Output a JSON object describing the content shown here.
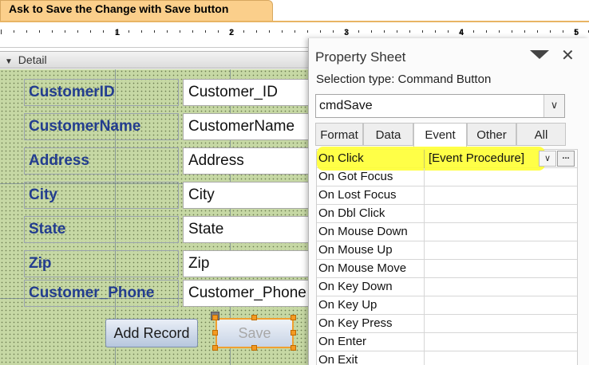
{
  "window": {
    "title": "Ask to Save the Change with Save button"
  },
  "ruler": {
    "numbers": [
      "1",
      "2",
      "3",
      "4",
      "5"
    ]
  },
  "detail_section": {
    "label": "Detail",
    "collapse_icon": "chevron-down-icon"
  },
  "form_fields": [
    {
      "label": "CustomerID",
      "control": "Customer_ID"
    },
    {
      "label": "CustomerName",
      "control": "CustomerName"
    },
    {
      "label": "Address",
      "control": "Address"
    },
    {
      "label": "City",
      "control": "City"
    },
    {
      "label": "State",
      "control": "State"
    },
    {
      "label": "Zip",
      "control": "Zip"
    },
    {
      "label": "Customer_Phone",
      "control": "Customer_Phone"
    }
  ],
  "buttons": {
    "add_record": "Add Record",
    "save": "Save"
  },
  "property_sheet": {
    "title": "Property Sheet",
    "selection_type": "Selection type:  Command Button",
    "selected_object": "cmdSave",
    "tabs": [
      "Format",
      "Data",
      "Event",
      "Other",
      "All"
    ],
    "active_tab": "Event",
    "properties": [
      {
        "name": "On Click",
        "value": "[Event Procedure]"
      },
      {
        "name": "On Got Focus",
        "value": ""
      },
      {
        "name": "On Lost Focus",
        "value": ""
      },
      {
        "name": "On Dbl Click",
        "value": ""
      },
      {
        "name": "On Mouse Down",
        "value": ""
      },
      {
        "name": "On Mouse Up",
        "value": ""
      },
      {
        "name": "On Mouse Move",
        "value": ""
      },
      {
        "name": "On Key Down",
        "value": ""
      },
      {
        "name": "On Key Up",
        "value": ""
      },
      {
        "name": "On Key Press",
        "value": ""
      },
      {
        "name": "On Enter",
        "value": ""
      },
      {
        "name": "On Exit",
        "value": ""
      }
    ],
    "build_button": "...",
    "highlight_color": "#ffff33"
  },
  "colors": {
    "grid_bg": "#c6d8a4",
    "label_text": "#233d8f",
    "title_tab": "#fbcf8b",
    "selection_handle": "#f39a22"
  }
}
